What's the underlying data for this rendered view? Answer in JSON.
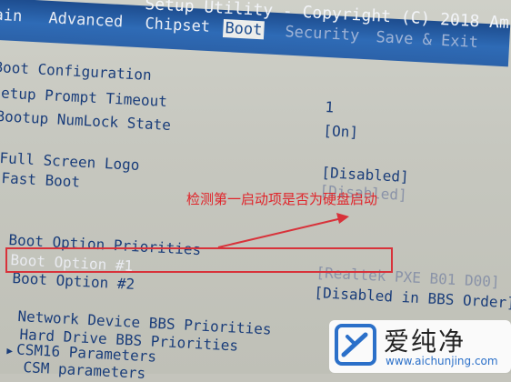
{
  "header": {
    "title_fragment": "Setup Utility - Copyright (C) 2018 Am",
    "tabs": [
      "Main",
      "Advanced",
      "Chipset",
      "Boot",
      "Security",
      "Save & Exit"
    ],
    "active_tab": "Boot"
  },
  "boot_settings": {
    "section_title": "Boot Configuration",
    "setup_prompt_timeout_label": "Setup Prompt Timeout",
    "setup_prompt_timeout_value": "1",
    "bootup_numlock_label": "Bootup NumLock State",
    "bootup_numlock_value": "[On]",
    "full_screen_logo_label": "Full Screen Logo",
    "full_screen_logo_value": "[Disabled]",
    "fast_boot_label": "Fast Boot",
    "fast_boot_value": "[Disabled]",
    "priorities_title": "Boot Option Priorities",
    "boot_option_1_label": "Boot Option #1",
    "boot_option_1_value": "[Realtek PXE B01 D00]",
    "boot_option_2_label": "Boot Option #2",
    "boot_option_2_value": "[Disabled in BBS Order]",
    "network_bbs_label": "Network Device BBS Priorities",
    "hdd_bbs_label": "Hard Drive BBS Priorities",
    "csm16_label": "CSM16 Parameters",
    "csm_label": "CSM parameters"
  },
  "annotation": {
    "text": "检测第一启动项是否为硬盘启动",
    "color": "#e0242a"
  },
  "watermark": {
    "brand": "爱纯净",
    "url": "www.aichunjing.com"
  },
  "colors": {
    "header_blue": "#2e6bb6",
    "text_blue": "#1a3d7a",
    "highlight_red": "#d8323a"
  }
}
